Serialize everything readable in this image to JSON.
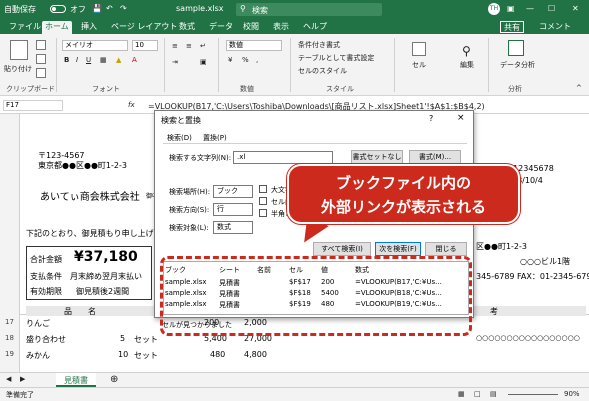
{
  "titlebar": {
    "autosave": "自動保存",
    "autosave_state": "オフ",
    "filename": "sample.xlsx",
    "search_placeholder": "検索",
    "user_initial": "TH"
  },
  "ribbon_tabs": [
    "ファイル",
    "ホーム",
    "挿入",
    "ページ レイアウト",
    "数式",
    "データ",
    "校閲",
    "表示",
    "ヘルプ"
  ],
  "ribbon_right": {
    "share": "共有",
    "comment": "コメント"
  },
  "ribbon": {
    "paste": "貼り付け",
    "clipboard": "クリップボード",
    "font_name": "メイリオ",
    "font_size": "10",
    "font_group": "フォント",
    "number_format": "数値",
    "number_group": "数値",
    "cond_format": "条件付き書式",
    "table_format": "テーブルとして書式設定",
    "cell_style": "セルのスタイル",
    "style_group": "スタイル",
    "cells": "セル",
    "edit": "編集",
    "analyze": "データ分析",
    "analyze_group": "分析"
  },
  "formula_bar": {
    "namebox": "F17",
    "fx": "fx",
    "formula": "=VLOOKUP(B17,'C:\\Users\\Toshiba\\Downloads\\[商品リスト.xlsx]Sheet1'!$A$1:$B$4,2)"
  },
  "sheet": {
    "postal": "〒123-4567",
    "address": "東京都●●区●●町1-2-3",
    "company": "あいてぃ商会株式会社",
    "onchu": "御中",
    "intro": "下記のとおり、御見積もり申し上げます。",
    "total_label": "合計金額",
    "total_value": "¥37,180",
    "payment_label": "支払条件",
    "payment_value": "月末締め翌月末払い",
    "validity_label": "有効期限",
    "validity_value": "御見積後2週間",
    "col_item": "品　　名",
    "col_note": "考",
    "right_phone": "012345678",
    "right_date": "18/10/4",
    "right_addr": "区●●町1-2-3",
    "right_bldg": "○○○ビル1階",
    "right_tel": "345-6789  FAX：01-2345-6790",
    "right_circles": "○○○○○○○○○○○○○○○○○",
    "row_numbers": [
      "13",
      "14",
      "15",
      "16",
      "17",
      "18",
      "19",
      "20"
    ],
    "items": [
      {
        "name": "りんご",
        "qty": "",
        "unit": "",
        "price": "200",
        "amount": "2,000"
      },
      {
        "name": "盛り合わせ",
        "qty": "5",
        "unit": "セット",
        "price": "5,400",
        "amount": "27,000"
      },
      {
        "name": "みかん",
        "qty": "10",
        "unit": "セット",
        "price": "480",
        "amount": "4,800"
      }
    ],
    "sheet_tab": "見積書",
    "status": "準備完了",
    "zoom": "90%"
  },
  "dialog": {
    "title": "検索と置換",
    "help": "?",
    "close": "×",
    "tab_find": "検索(D)",
    "tab_replace": "置換(P)",
    "find_label": "検索する文字列(N):",
    "find_value": ".xl",
    "no_format": "書式セットなし",
    "format_btn": "書式(M)...",
    "within_label": "検索場所(H):",
    "within_value": "ブック",
    "search_label": "検索方向(S):",
    "search_value": "行",
    "lookin_label": "検索対象(L):",
    "lookin_value": "数式",
    "opt_case": "大文字と",
    "opt_cell": "セル内容",
    "opt_width": "半角と全",
    "find_all": "すべて検索(I)",
    "find_next": "次を検索(F)",
    "close_btn": "閉じる",
    "result_headers": [
      "ブック",
      "シート",
      "名前",
      "セル",
      "値",
      "数式"
    ],
    "results": [
      {
        "book": "sample.xlsx",
        "sheet": "見積書",
        "name": "",
        "cell": "$F$17",
        "value": "200",
        "formula": "=VLOOKUP(B17,'C:¥Us..."
      },
      {
        "book": "sample.xlsx",
        "sheet": "見積書",
        "name": "",
        "cell": "$F$18",
        "value": "5400",
        "formula": "=VLOOKUP(B18,'C:¥Us..."
      },
      {
        "book": "sample.xlsx",
        "sheet": "見積書",
        "name": "",
        "cell": "$F$19",
        "value": "480",
        "formula": "=VLOOKUP(B19,'C:¥Us..."
      }
    ],
    "found_count": "セルが見つかりました"
  },
  "callout": {
    "line1": "ブックファイル内の",
    "line2": "外部リンクが表示される"
  },
  "colors": {
    "excel_green": "#217346",
    "callout_red": "#cc2a1d"
  }
}
